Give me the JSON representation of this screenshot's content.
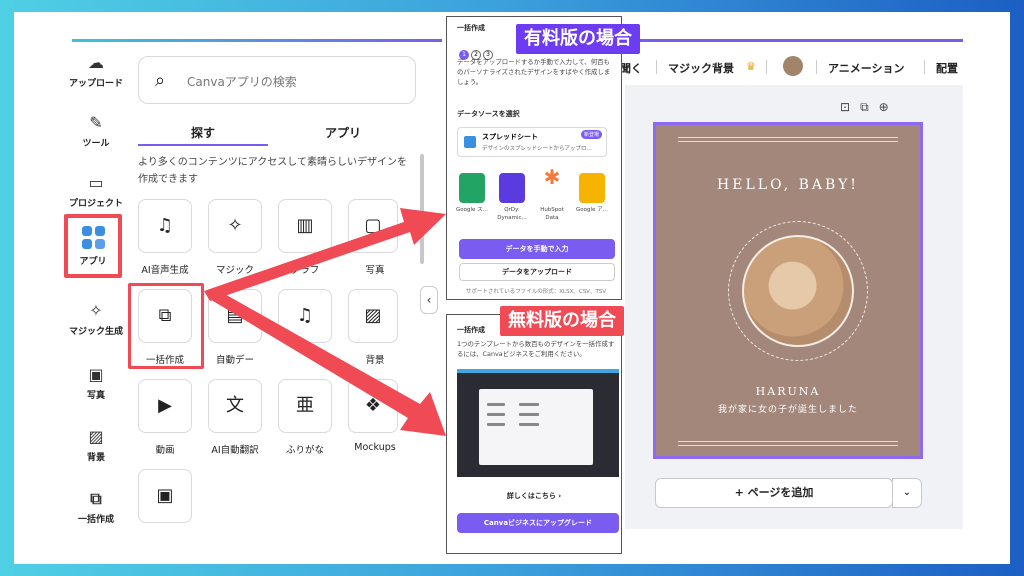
{
  "rail": {
    "upload": "アップロード",
    "tools": "ツール",
    "project": "プロジェクト",
    "apps": "アプリ",
    "magic": "マジック生成",
    "photo": "写真",
    "background": "背景",
    "bulk": "一括作成"
  },
  "panel": {
    "search_placeholder": "Canvaアプリの検索",
    "tab_explore": "探す",
    "tab_apps": "アプリ",
    "description": "より多くのコンテンツにアクセスして素晴らしいデザインを作成できます",
    "tiles": [
      "AI音声生成",
      "マジック",
      "グラフ",
      "写真",
      "一括作成",
      "自動デー",
      "",
      "背景",
      "動画",
      "AI自動翻訳",
      "ふりがな",
      "Mockups"
    ]
  },
  "editor": {
    "menu_1": "聞く",
    "menu_2": "マジック背景",
    "menu_3": "アニメーション",
    "menu_4": "配置",
    "card_title": "HELLO, BABY!",
    "card_name": "HARUNA",
    "card_sub": "我が家に女の子が誕生しました",
    "add_page": "+ ページを追加"
  },
  "paid_panel": {
    "badge": "有料版の場合",
    "title": "一括作成",
    "steps": [
      "1",
      "2",
      "3"
    ],
    "text": "データをアップロードするか手動で入力して、何百ものパーソナライズされたデザインをすばやく作成しましょう。",
    "source_heading": "データソースを選択",
    "sheet_title": "スプレッドシート",
    "sheet_sub": "デザインのスプレッドシートからアップロ...",
    "new_badge": "新登場",
    "sources": [
      "Google ス...",
      "QrDy: Dynamic...",
      "HubSpot Data",
      "Google ア..."
    ],
    "manual_button": "データを手動で入力",
    "upload_button": "データをアップロード",
    "formats": "サポートされているファイルの形式：XLSX、CSV、TSV"
  },
  "free_panel": {
    "badge": "無料版の場合",
    "title": "一括作成",
    "text": "1つのテンプレートから数百ものデザインを一括作成するには、Canvaビジネスをご利用ください。",
    "link": "詳しくはこちら ›",
    "upgrade_button": "Canvaビジネスにアップグレード"
  },
  "colors": {
    "accent": "#7b5cf0",
    "highlight": "#f04a55",
    "card_bg": "#a3877a"
  }
}
